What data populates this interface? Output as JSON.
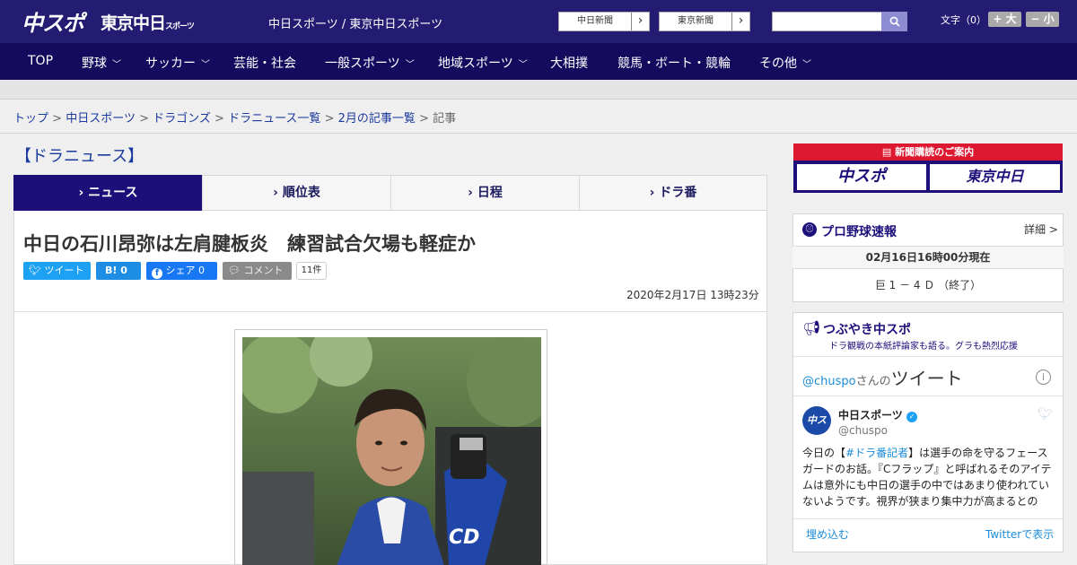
{
  "header": {
    "logo_main": "中スポ",
    "logo_tokyo": "東京中日",
    "logo_tokyo_small": "スポーツ",
    "site_name": "中日スポーツ / 東京中日スポーツ",
    "link_chunichi": "中日新聞",
    "link_tokyo": "東京新聞",
    "font_label": "文字（0）",
    "font_up": "+ 大",
    "font_down": "− 小"
  },
  "nav": {
    "items": [
      "TOP",
      "野球",
      "サッカー",
      "芸能・社会",
      "一般スポーツ",
      "地域スポーツ",
      "大相撲",
      "競馬・ボート・競輪",
      "その他"
    ]
  },
  "breadcrumb": {
    "items": [
      "トップ",
      "中日スポーツ",
      "ドラゴンズ",
      "ドラニュース一覧",
      "2月の記事一覧"
    ],
    "current": "記事",
    "sep": ">"
  },
  "section_title": "【ドラニュース】",
  "tabs": [
    "ニュース",
    "順位表",
    "日程",
    "ドラ番"
  ],
  "article": {
    "title": "中日の石川昂弥は左肩腱板炎　練習試合欠場も軽症か",
    "tweet_label": "ツイート",
    "hatena_label": "B! 0",
    "share_label": "シェア 0",
    "comment_label": "コメント",
    "comment_count": "11件",
    "date": "2020年2月17日 13時23分"
  },
  "sidebar": {
    "subscribe": {
      "heading": "新聞購読のご案内",
      "logo1": "中スポ",
      "logo2": "東京中日"
    },
    "baseball": {
      "title": "プロ野球速報",
      "detail": "詳細 >",
      "date": "02月16日16時00分現在",
      "score": "巨 1 － 4 Ｄ （終了）"
    },
    "twitter": {
      "title": "つぶやき中スポ",
      "subtitle": "ドラ観戦の本紙評論家も語る。グラも熱烈応援",
      "handle": "@chuspo",
      "handle_suffix": "さんの",
      "tweets_label": "ツイート",
      "name": "中日スポーツ",
      "user_id": "@chuspo",
      "avatar_text": "中スポ",
      "body_pre": "今日の【",
      "hashtag": "#ドラ番記者",
      "body_post": "】は選手の命を守るフェースガードのお話。『Cフラップ』と呼ばれるそのアイテムは意外にも中日の選手の中ではあまり使われていないようです。視界が狭まり集中力が高まるとの",
      "embed": "埋め込む",
      "view": "Twitterで表示"
    }
  },
  "colors": {
    "header": "#231c72",
    "nav": "#150b5e",
    "accent": "#1c0f7a",
    "link": "#1b3a9d",
    "twitter": "#1da1f2",
    "subscribe_red": "#dd1931"
  }
}
